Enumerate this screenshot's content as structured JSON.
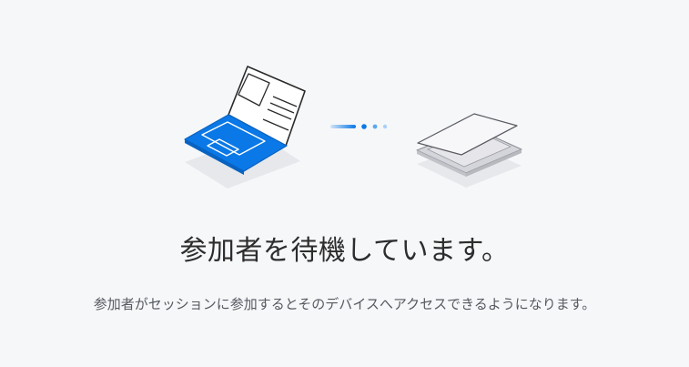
{
  "status": {
    "title": "参加者を待機しています。",
    "description": "参加者がセッションに参加するとそのデバイスへアクセスできるようになります。"
  },
  "illustration": {
    "local_device_icon": "open-laptop-icon",
    "connection_icon": "connecting-dots-icon",
    "remote_device_icon": "closed-laptop-icon",
    "accent_color": "#0a78e6",
    "remote_color": "#d9dade"
  }
}
